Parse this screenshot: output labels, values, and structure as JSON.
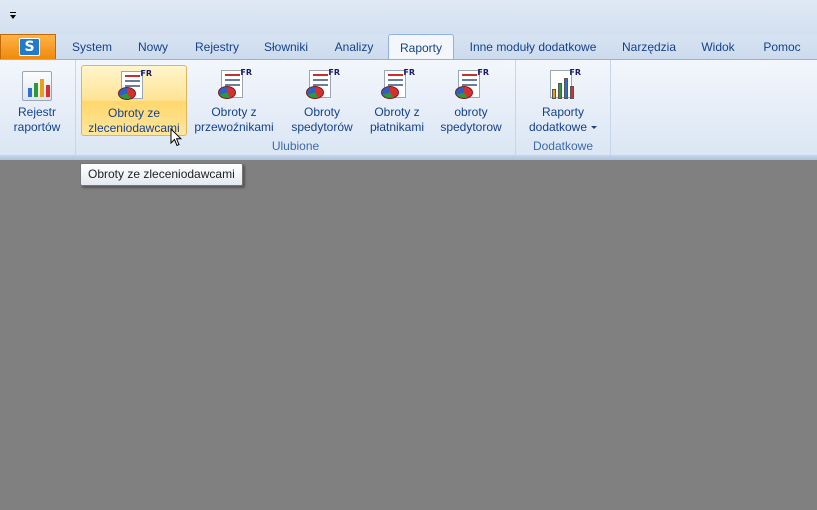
{
  "quick_access": {
    "customize_icon": "dropdown-arrow-icon"
  },
  "app_button": {
    "logo_icon": "app-logo-icon",
    "logo_text": "S"
  },
  "tabs": [
    {
      "label": "System",
      "active": false
    },
    {
      "label": "Nowy",
      "active": false
    },
    {
      "label": "Rejestry",
      "active": false
    },
    {
      "label": "Słowniki",
      "active": false
    },
    {
      "label": "Analizy",
      "active": false
    },
    {
      "label": "Raporty",
      "active": true
    },
    {
      "label": "Inne moduły dodatkowe",
      "active": false
    },
    {
      "label": "Narzędzia",
      "active": false
    },
    {
      "label": "Widok",
      "active": false
    },
    {
      "label": "Pomoc",
      "active": false
    }
  ],
  "ribbon": {
    "register": {
      "line1": "Rejestr",
      "line2": "raportów",
      "icon": "bar-chart-icon"
    },
    "favorites": {
      "label": "Ulubione",
      "buttons": [
        {
          "line1": "Obroty ze",
          "line2": "zleceniodawcami",
          "icon": "report-pie-icon",
          "hover": true
        },
        {
          "line1": "Obroty z",
          "line2": "przewoźnikami",
          "icon": "report-pie-icon"
        },
        {
          "line1": "Obroty",
          "line2": "spedytorów",
          "icon": "report-pie-icon"
        },
        {
          "line1": "Obroty z",
          "line2": "płatnikami",
          "icon": "report-pie-icon"
        },
        {
          "line1": "obroty",
          "line2": "spedytorow",
          "icon": "report-pie-icon"
        }
      ]
    },
    "additional": {
      "label": "Dodatkowe",
      "button": {
        "line1": "Raporty",
        "line2": "dodatkowe",
        "icon": "report-chart-icon"
      }
    },
    "report_badge": "FR"
  },
  "tooltip": {
    "text": "Obroty ze zleceniodawcami"
  }
}
